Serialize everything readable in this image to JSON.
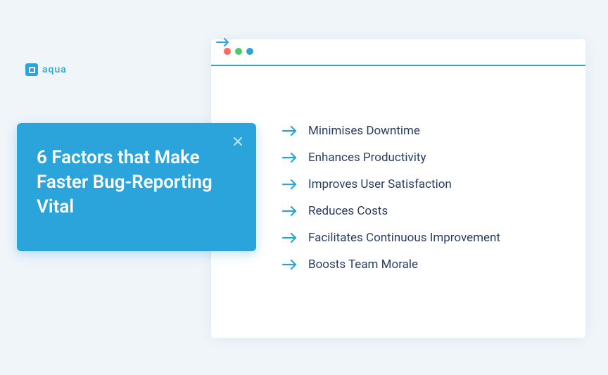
{
  "logo": {
    "text": "aqua"
  },
  "card": {
    "title": "6 Factors that Make Faster Bug-Reporting Vital"
  },
  "factors": [
    "Minimises Downtime",
    "Enhances Productivity",
    "Improves User Satisfaction",
    "Reduces Costs",
    "Facilitates Continuous Improvement",
    "Boosts Team Morale"
  ]
}
